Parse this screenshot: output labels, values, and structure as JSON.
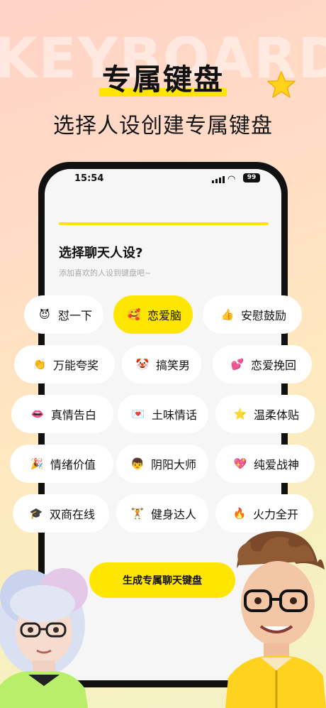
{
  "hero": {
    "bg_word": "KEYBOARD",
    "title": "专属键盘",
    "subtitle": "选择人设创建专属键盘"
  },
  "status_bar": {
    "time": "15:54",
    "battery": "99"
  },
  "page": {
    "progress": 1.0,
    "question": "选择聊天人设?",
    "hint": "添加喜欢的人设到键盘吧~"
  },
  "personas": [
    {
      "label": "怼一下",
      "icon": "devil-face-icon",
      "glyph": "😈",
      "selected": false
    },
    {
      "label": "恋爱脑",
      "icon": "lovestruck-face-icon",
      "glyph": "🥰",
      "selected": true
    },
    {
      "label": "安慰鼓励",
      "icon": "thumbs-up-heart-icon",
      "glyph": "👍",
      "selected": false
    },
    {
      "label": "万能夸奖",
      "icon": "clapping-hands-icon",
      "glyph": "👏",
      "selected": false
    },
    {
      "label": "搞笑男",
      "icon": "clown-face-icon",
      "glyph": "🤡",
      "selected": false
    },
    {
      "label": "恋爱挽回",
      "icon": "chat-hearts-icon",
      "glyph": "💕",
      "selected": false
    },
    {
      "label": "真情告白",
      "icon": "lips-icon",
      "glyph": "👄",
      "selected": false
    },
    {
      "label": "土味情话",
      "icon": "love-message-icon",
      "glyph": "💌",
      "selected": false
    },
    {
      "label": "温柔体贴",
      "icon": "star-icon",
      "glyph": "⭐",
      "selected": false
    },
    {
      "label": "情绪价值",
      "icon": "party-popper-icon",
      "glyph": "🎉",
      "selected": false
    },
    {
      "label": "阴阳大师",
      "icon": "boy-face-icon",
      "glyph": "👦",
      "selected": false
    },
    {
      "label": "纯爱战神",
      "icon": "sparkling-heart-icon",
      "glyph": "💖",
      "selected": false
    },
    {
      "label": "双商在线",
      "icon": "graduation-cap-icon",
      "glyph": "🎓",
      "selected": false
    },
    {
      "label": "健身达人",
      "icon": "kettlebell-icon",
      "glyph": "🏋",
      "selected": false
    },
    {
      "label": "火力全开",
      "icon": "fire-icon",
      "glyph": "🔥",
      "selected": false
    }
  ],
  "cta": "生成专属聊天键盘",
  "colors": {
    "accent": "#ffe600",
    "text": "#111111",
    "hint": "#aaaaaa"
  }
}
